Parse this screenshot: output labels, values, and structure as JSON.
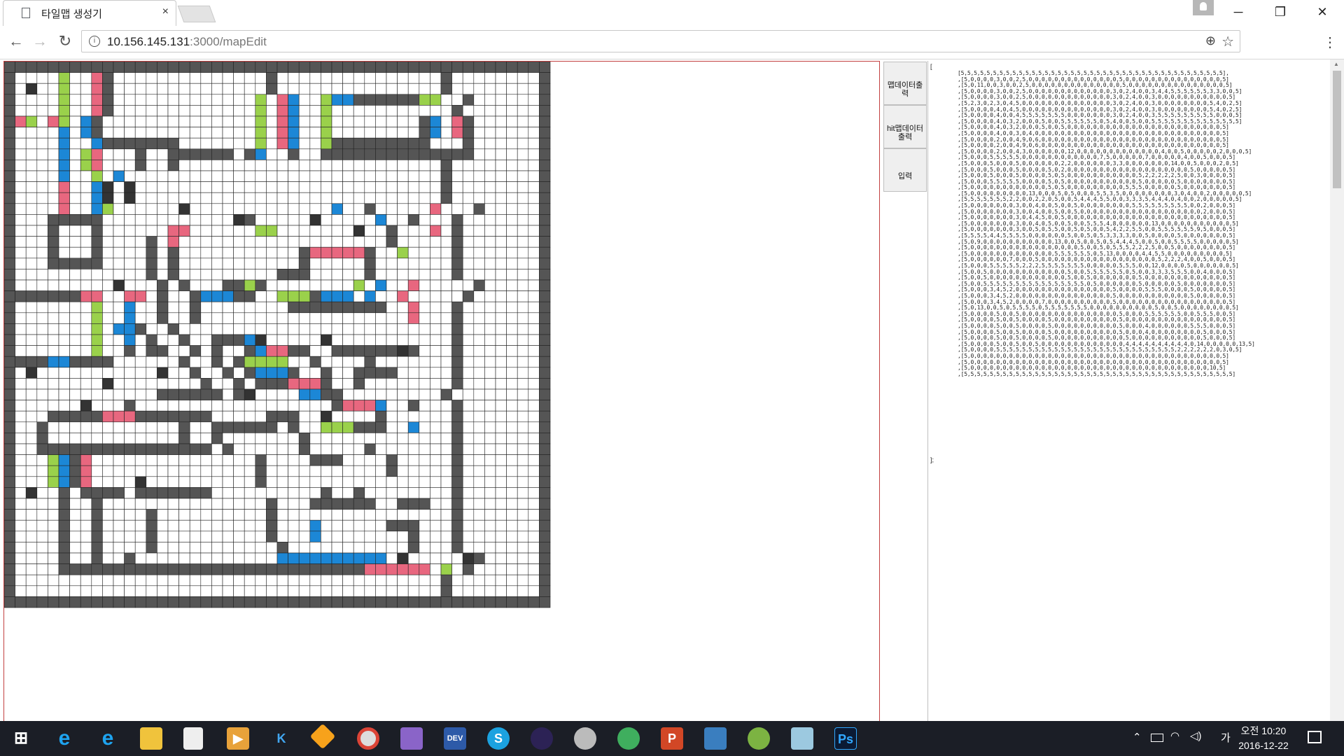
{
  "browser": {
    "tab_title": "타일맵 생성기",
    "tab_close": "×",
    "url_host": "10.156.145.131",
    "url_rest": ":3000/mapEdit",
    "window_controls": [
      "─",
      "❐",
      "✕"
    ],
    "nav": {
      "back": "←",
      "forward": "→",
      "reload": "↻"
    },
    "icons": {
      "info": "i",
      "zoom": "⊕",
      "star": "☆",
      "menu": "⋮"
    }
  },
  "side_buttons": {
    "output_mapdata": "맵데이터출력",
    "output_hitmapdata": "hit맵데이터출력",
    "input": "입력"
  },
  "data_panel": {
    "open_bracket": "[",
    "close_bracket": "];",
    "rows": [
      "[5,5,5,5,5,5,5,5,5,5,5,5,5,5,5,5,5,5,5,5,5,5,5,5,5,5,5,5,5,5,5,5,5,5,5,5,5,5,5,5,5],",
      ",[5,0,0,0,0,3,0,0,2,5,0,0,0,0,0,0,0,0,0,0,0,0,0,0,5,0,0,0,0,0,0,0,0,0,0,0,0,0,0,0,5]",
      ",[5,0,11,0,0,3,0,0,2,5,0,0,0,0,0,0,0,0,0,0,0,0,0,0,5,0,0,0,0,0,0,0,0,0,0,0,0,0,0,0,5]",
      ",[5,0,0,0,0,3,0,0,2,5,0,0,0,0,0,0,0,0,0,0,0,0,0,3,0,2,4,0,0,3,4,4,5,5,5,5,5,5,3,3,0,0,5]",
      ",[5,0,0,0,0,3,0,0,2,5,0,0,0,0,0,0,0,0,0,0,0,0,0,3,0,2,4,0,0,3,0,0,0,0,0,0,0,0,0,0,0,5]",
      ",[5,2,3,0,2,3,0,4,5,0,0,0,0,0,0,0,0,0,0,0,0,0,0,3,0,2,4,0,0,3,0,0,0,0,0,0,0,0,5,4,0,2,5]",
      ",[5,0,0,0,0,4,0,4,5,0,0,0,0,0,0,0,0,0,0,0,0,0,0,3,0,2,4,0,0,3,0,0,0,0,0,0,0,0,5,4,0,2,5]",
      ",[5,0,0,0,0,4,0,0,4,5,5,5,5,5,5,5,0,0,0,0,0,0,0,3,0,2,4,0,0,3,5,5,5,5,5,5,5,5,5,0,0,0,5]",
      ",[5,0,0,0,0,4,0,3,2,0,0,0,5,0,0,5,5,5,5,5,5,0,5,4,0,0,5,0,0,5,5,5,5,5,5,5,5,5,5,5,5,5,5]",
      ",[5,0,0,0,0,4,0,3,2,0,0,0,5,0,0,5,0,0,0,0,0,0,0,0,0,0,0,0,0,0,0,0,0,0,0,0,0,0,0,0,5]",
      ",[5,0,0,0,0,4,0,0,3,0,4,0,0,0,0,0,0,0,0,0,0,0,0,0,0,0,0,0,0,0,0,0,0,0,0,0,0,0,0,0,5]",
      ",[5,0,0,0,0,2,0,0,4,9,0,6,0,0,0,0,0,0,0,0,0,0,0,0,0,0,0,0,0,0,0,0,0,0,0,0,0,0,0,0,5]",
      ",[5,0,0,0,0,2,0,0,4,9,0,6,0,0,0,0,0,0,0,0,0,0,0,0,0,0,0,0,0,0,0,0,0,0,0,0,0,0,0,0,5]",
      ",[5,0,0,0,0,2,0,0,4,3,0,0,0,0,0,0,12,0,0,0,0,0,0,0,0,0,0,0,0,0,4,0,0,5,0,0,0,0,0,2,0,0,0,5]",
      ",[5,0,0,0,5,5,5,5,5,0,0,0,0,0,0,0,0,0,0,0,0,7,5,0,0,0,0,0,7,0,0,0,0,0,4,0,0,5,0,0,0,5]",
      ",[5,0,0,0,5,0,0,0,5,0,0,0,0,0,0,2,2,0,0,0,0,0,0,3,3,0,0,0,0,0,0,0,14,0,0,5,0,0,0,2,0,5]",
      ",[5,0,0,0,5,0,0,0,5,0,0,0,0,5,0,2,0,0,0,0,0,0,0,0,0,0,0,0,0,0,0,0,0,0,0,5,0,0,0,0,0,5]",
      ",[5,0,0,0,5,0,0,0,5,0,0,0,0,5,0,5,0,0,0,0,0,0,0,0,0,0,0,5,2,2,2,2,2,5,0,0,3,0,0,0,0,5]",
      ",[5,0,0,0,5,5,5,5,5,0,0,0,0,5,0,5,0,0,0,0,0,0,0,0,0,0,0,5,0,0,0,0,0,5,0,0,0,0,0,0,0,5]",
      ",[5,0,0,0,0,0,0,0,0,0,0,0,0,5,0,5,0,0,0,0,0,0,0,0,0,5,5,5,0,0,0,0,0,5,0,0,0,0,0,0,0,5]",
      ",[5,0,0,0,0,0,0,0,0,0,13,0,0,0,5,0,5,0,0,0,5,5,3,5,0,0,0,0,0,0,0,0,3,0,4,0,0,2,0,0,0,0,0,5]",
      ",[5,5,5,5,5,5,5,2,2,0,0,2,2,0,5,0,0,5,4,4,4,5,5,0,0,3,3,3,5,4,4,4,0,4,0,0,2,0,0,0,0,0,5]",
      ",[5,0,0,0,0,0,0,0,3,0,0,4,0,0,5,0,0,5,0,0,0,0,0,0,0,0,5,5,5,5,5,5,5,5,5,0,0,2,0,0,0,5]",
      ",[5,0,0,0,0,0,0,0,3,0,0,4,0,0,5,0,0,5,0,0,0,0,0,0,0,0,0,0,0,0,0,0,0,0,0,0,0,2,0,0,0,5]",
      ",[5,0,0,0,0,0,0,0,3,0,4,4,5,0,0,5,0,0,0,0,0,0,0,0,0,0,0,0,0,0,0,0,0,0,0,0,0,0,0,0,0,5]",
      ",[5,0,0,0,0,0,0,0,3,0,0,4,0,5,0,0,5,0,0,5,5,5,4,8,0,0,0,0,0,13,0,0,0,0,0,0,0,0,0,0,0,5]",
      ",[5,0,0,0,0,0,0,0,3,0,0,5,0,5,5,0,0,5,0,5,0,0,5,4,2,2,5,5,0,0,5,5,5,5,5,5,9,5,0,0,0,5]",
      ",[5,5,5,5,4,4,5,5,5,5,0,0,0,0,0,0,5,0,0,5,0,5,3,3,3,3,0,0,5,0,0,0,0,5,0,0,0,0,0,0,0,5]",
      ",[5,0,9,0,0,0,0,0,0,0,0,0,0,0,13,0,0,5,0,0,5,0,5,4,4,4,5,0,0,5,0,0,5,5,5,5,0,0,0,0,0,5]",
      ",[5,0,0,0,0,0,0,0,0,8,0,0,0,0,0,0,0,0,5,0,0,5,0,5,5,5,2,2,2,5,0,0,5,0,0,0,0,0,0,0,0,5]",
      ",[5,0,0,0,0,0,0,0,0,0,0,0,0,0,5,5,5,5,5,5,0,5,13,0,0,0,0,4,4,5,5,0,0,0,0,0,0,0,0,0,5]",
      ",[5,0,0,0,0,0,0,7,0,0,0,5,0,0,0,0,0,0,0,0,0,0,0,0,0,0,0,0,0,0,5,2,2,2,4,0,0,5,0,0,0,5]",
      ",[5,0,0,0,5,5,5,5,5,2,2,2,5,5,5,5,5,5,5,0,0,0,0,0,5,5,5,0,0,12,0,0,0,0,5,0,0,0,0,0,0,5]",
      ",[5,0,0,5,0,0,0,0,0,0,0,0,0,0,0,0,5,0,0,5,5,5,5,5,5,0,5,0,0,3,3,3,5,5,5,0,0,4,0,0,0,5]",
      ",[5,0,0,5,0,0,0,0,0,0,0,0,0,0,0,0,5,0,0,5,0,0,0,0,0,0,0,5,0,0,0,0,0,0,0,0,0,0,0,0,0,5]",
      ",[5,0,0,5,5,5,5,5,5,5,5,5,5,5,5,5,5,5,5,0,5,0,0,0,0,0,0,5,0,0,0,0,0,5,0,0,0,0,0,0,0,5]",
      ",[5,0,0,0,3,4,5,2,0,0,0,0,0,0,0,0,0,0,0,0,0,0,0,5,0,0,0,0,5,5,5,0,0,0,0,5,0,0,0,0,0,5]",
      ",[5,0,0,0,3,4,5,2,0,0,0,0,0,0,0,0,0,0,0,0,0,0,0,5,0,0,0,0,0,0,0,0,0,0,0,5,0,0,0,0,0,5]",
      ",[5,0,0,0,3,4,5,2,0,0,0,0,7,0,0,0,0,0,0,0,0,0,0,5,0,0,0,0,0,0,0,0,0,0,0,0,0,0,0,0,0,5]",
      ",[5,0,13,0,0,5,0,5,5,5,5,0,5,5,5,5,5,5,5,0,0,0,0,0,0,0,0,0,0,5,0,0,5,0,0,0,0,0,0,0,0,5]",
      ",[5,0,0,0,0,5,0,0,5,0,0,0,0,0,0,0,0,0,0,0,0,0,0,0,5,0,0,0,5,5,5,5,5,5,0,0,5,5,5,0,0,5]",
      ",[5,0,0,0,0,5,0,0,5,0,0,0,0,5,0,0,0,0,0,0,0,0,0,0,5,0,0,0,0,0,0,0,0,0,0,0,0,0,0,0,0,5]",
      ",[5,0,0,0,0,5,0,0,5,0,0,0,0,5,0,0,0,0,0,0,0,0,0,0,5,0,0,0,4,0,0,0,0,0,0,5,5,5,0,0,0,5]",
      ",[5,0,0,0,0,5,0,0,5,0,0,0,0,5,0,0,0,0,0,0,0,0,0,0,5,0,0,0,4,0,0,0,0,0,0,0,0,5,0,0,0,5]",
      ",[5,0,0,0,0,5,0,0,5,0,0,0,0,5,0,0,0,0,0,0,0,0,0,0,0,5,0,0,0,0,0,0,0,0,0,0,0,5,0,0,0,5]",
      ",[5,0,0,0,0,5,0,0,5,0,0,5,0,0,0,0,0,0,0,0,0,0,0,0,0,4,4,4,4,4,4,4,4,4,4,0,14,0,0,0,0,0,13,5]",
      ",[5,0,0,0,0,5,5,5,5,5,5,5,5,5,5,5,5,5,5,5,5,5,5,5,5,5,5,5,5,5,5,5,5,2,2,2,2,2,2,0,3,0,5]",
      ",[5,0,0,0,0,0,0,0,0,0,0,0,0,0,0,0,0,0,0,0,0,0,0,0,0,0,0,0,0,0,0,0,0,0,0,0,0,0,0,0,5]",
      ",[5,0,0,0,0,0,0,0,0,0,0,0,0,0,0,0,0,0,0,0,0,0,0,0,0,0,0,0,0,0,0,0,0,0,0,0,0,0,0,0,5]",
      ",[5,0,0,0,0,0,0,0,0,0,0,0,0,0,0,0,0,0,0,0,0,0,0,0,0,0,0,0,0,0,0,0,0,0,0,0,0,0,10,5]",
      ",[5,5,5,5,5,5,5,5,5,5,5,5,5,5,5,5,5,5,5,5,5,5,5,5,5,5,5,5,5,5,5,5,5,5,5,5,5,5,5,5,5,5]"
    ]
  },
  "taskbar": {
    "apps": [
      "start",
      "internet-explorer",
      "edge",
      "file-explorer",
      "store",
      "media-player",
      "visual-studio-code",
      "sketch",
      "chrome",
      "visual-studio",
      "dev-cpp",
      "skype",
      "eclipse",
      "postman",
      "atom",
      "powerpoint",
      "file-manager",
      "android-studio",
      "notepad",
      "photoshop"
    ],
    "labels": {
      "ie": "e",
      "edge": "e",
      "vs": "K",
      "dev": "DEV",
      "skype": "S",
      "ppt": "P",
      "ps": "Ps"
    },
    "ime": "가",
    "time": "오전 10:20",
    "date": "2016-12-22"
  },
  "colors": {
    "wall": "#555555",
    "pink": "#e8677f",
    "green": "#9ad14b",
    "blue": "#1c87d6",
    "panel_border": "#c34141",
    "taskbar": "#1b1e26"
  }
}
